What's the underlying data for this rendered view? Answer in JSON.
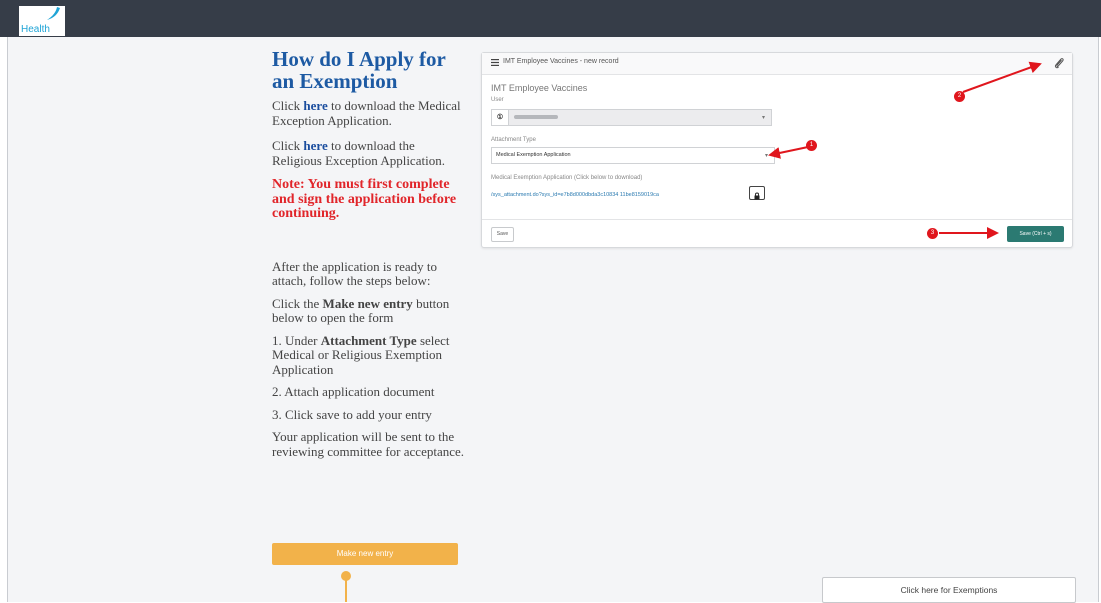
{
  "header": {
    "logo_text": "Health"
  },
  "instructions": {
    "title": "How do I Apply for an Exemption",
    "p1_before": "Click ",
    "p1_link": "here",
    "p1_after": " to download the Medical Exception Application.",
    "p2_before": "Click ",
    "p2_link": "here",
    "p2_after": " to download the Religious Exception Application.",
    "note": "Note: You must first complete and sign the application before continuing.",
    "p3": "After the application is ready to attach, follow the steps below:",
    "p4_before": "Click the ",
    "p4_bold": "Make new entry",
    "p4_after": " button below to open the form",
    "p5_before": "1. Under ",
    "p5_bold": "Attachment Type",
    "p5_after": " select Medical or Religious Exemption Application",
    "p6": "2. Attach application document",
    "p7": "3. Click save to add your entry",
    "p8": "Your application will be sent to the reviewing committee for acceptance.",
    "make_button": "Make new entry"
  },
  "form": {
    "header_title": "IMT Employee Vaccines - new record",
    "title": "IMT Employee Vaccines",
    "user_label": "User",
    "attachment_label": "Attachment Type",
    "attachment_value": "Medical Exemption Application",
    "download_label": "Medical Exemption Application (Click below to download)",
    "download_link": "/sys_attachment.do?sys_id=e7b8d000dbda3c10834 11be8159019ca",
    "save_left": "Save",
    "save_right": "Save (Ctrl + s)"
  },
  "markers": [
    "1",
    "2",
    "3"
  ],
  "footer": {
    "exemptions_button": "Click here for Exemptions"
  },
  "colors": {
    "topbar": "#363d48",
    "heading": "#1d5aa3",
    "note": "#e1252a",
    "make_button": "#f2b24a",
    "save_button": "#2b7a72",
    "marker": "#e0161d"
  }
}
